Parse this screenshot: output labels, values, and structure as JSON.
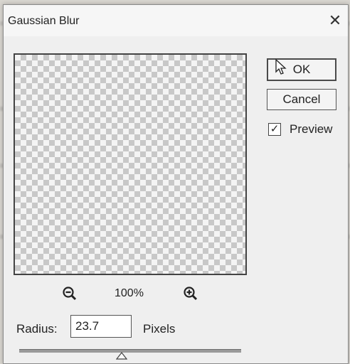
{
  "window": {
    "title": "Gaussian Blur"
  },
  "icons": {
    "close": "close-icon",
    "zoom_out": "zoom-out-icon",
    "zoom_in": "zoom-in-icon",
    "slider_thumb": "slider-thumb-icon",
    "cursor": "mouse-pointer-icon"
  },
  "buttons": {
    "ok": "OK",
    "cancel": "Cancel"
  },
  "preview": {
    "label": "Preview",
    "checked": true,
    "check_glyph": "✓"
  },
  "zoom": {
    "level": "100%"
  },
  "radius": {
    "label": "Radius:",
    "value": "23.7",
    "units": "Pixels",
    "slider_fraction": 0.45
  },
  "colors": {
    "dialog_bg": "#efefef",
    "checker_dark": "#c8c8c8",
    "checker_light": "#f4f4f4"
  }
}
